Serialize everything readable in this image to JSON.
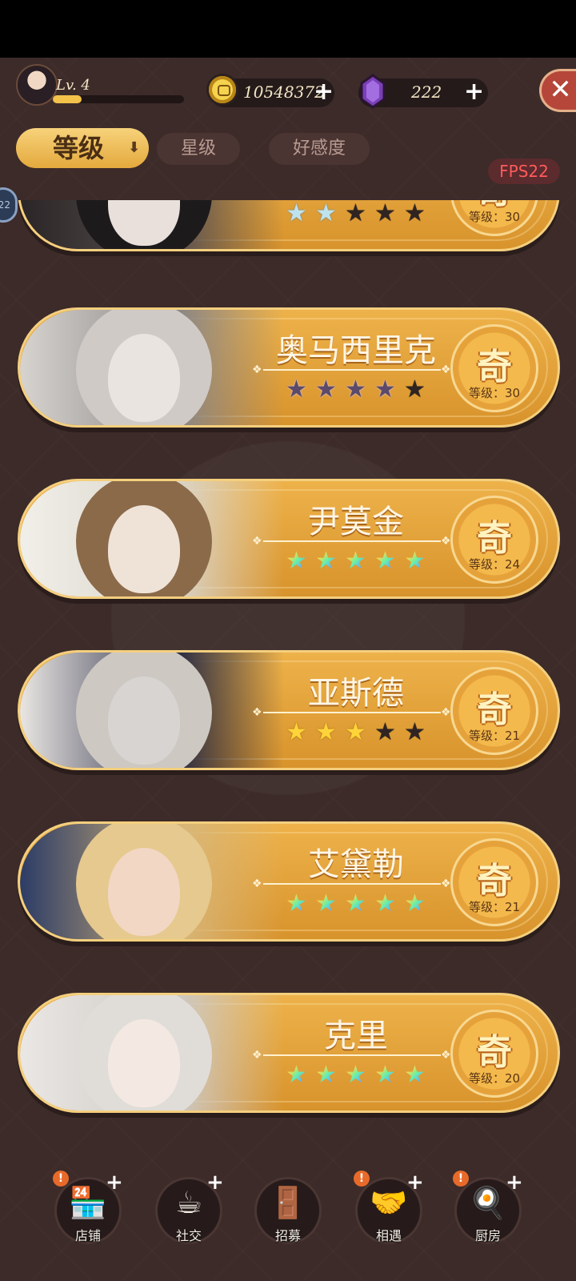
{
  "top": {
    "level_label": "Lv. 4",
    "level_progress": 0.22,
    "coins": "10548372",
    "gems": "222",
    "plus": "+",
    "close": "✕"
  },
  "tabs": {
    "level": "等级",
    "star": "星级",
    "affection": "好感度",
    "sort_arrow": "⬇"
  },
  "fps": "FPS22",
  "side_badge": "22",
  "cards": [
    {
      "name": "",
      "rank": "奇",
      "level": "等级：30",
      "stars": [
        "blue",
        "blue",
        "dark",
        "dark",
        "dark"
      ]
    },
    {
      "name": "奥马西里克",
      "rank": "奇",
      "level": "等级：30",
      "stars": [
        "purple",
        "purple",
        "purple",
        "purple",
        "dark"
      ]
    },
    {
      "name": "尹莫金",
      "rank": "奇",
      "level": "等级：24",
      "stars": [
        "rainbow",
        "rainbow",
        "rainbow",
        "rainbow",
        "rainbow"
      ]
    },
    {
      "name": "亚斯德",
      "rank": "奇",
      "level": "等级：21",
      "stars": [
        "gold",
        "gold",
        "gold",
        "dark",
        "dark"
      ]
    },
    {
      "name": "艾黛勒",
      "rank": "奇",
      "level": "等级：21",
      "stars": [
        "rainbow",
        "rainbow",
        "rainbow",
        "rainbow",
        "rainbow"
      ]
    },
    {
      "name": "克里",
      "rank": "奇",
      "level": "等级：20",
      "stars": [
        "rainbow",
        "rainbow",
        "rainbow",
        "rainbow",
        "rainbow"
      ]
    }
  ],
  "nav": [
    {
      "label": "店铺",
      "icon": "shop-icon",
      "glyph": "🏪",
      "alert": true,
      "plus": true
    },
    {
      "label": "社交",
      "icon": "coffee-cup-icon",
      "glyph": "☕",
      "alert": false,
      "plus": true
    },
    {
      "label": "招募",
      "icon": "door-icon",
      "glyph": "🚪",
      "alert": false,
      "plus": false
    },
    {
      "label": "相遇",
      "icon": "handshake-icon",
      "glyph": "🤝",
      "alert": true,
      "plus": true
    },
    {
      "label": "厨房",
      "icon": "frying-pan-icon",
      "glyph": "🍳",
      "alert": true,
      "plus": true
    }
  ],
  "colors": {
    "card": "#e6a43a",
    "background": "#3c2b29",
    "fps_text": "#ff5b5b",
    "close_button": "#b6463a"
  }
}
